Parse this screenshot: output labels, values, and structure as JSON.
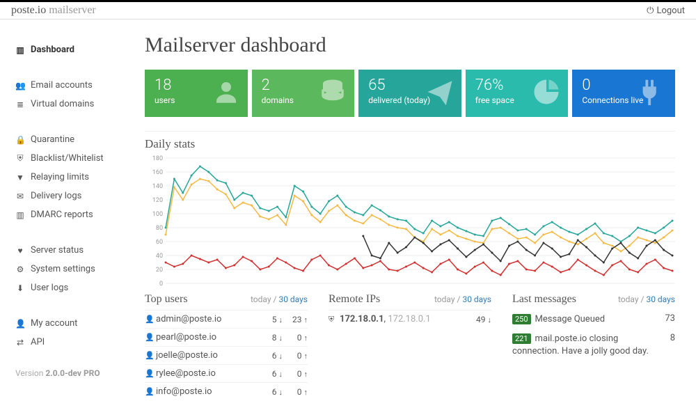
{
  "brand": {
    "main": "poste.io",
    "sub": "mailserver"
  },
  "logout_label": "Logout",
  "sidebar": {
    "groups": [
      [
        {
          "label": "Dashboard",
          "icon": "bars"
        }
      ],
      [
        {
          "label": "Email accounts",
          "icon": "users"
        },
        {
          "label": "Virtual domains",
          "icon": "db"
        }
      ],
      [
        {
          "label": "Quarantine",
          "icon": "lock"
        },
        {
          "label": "Blacklist/Whitelist",
          "icon": "shield"
        },
        {
          "label": "Relaying limits",
          "icon": "filter"
        },
        {
          "label": "Delivery logs",
          "icon": "mail"
        },
        {
          "label": "DMARC reports",
          "icon": "bars"
        }
      ],
      [
        {
          "label": "Server status",
          "icon": "heart"
        },
        {
          "label": "System settings",
          "icon": "gear"
        },
        {
          "label": "User logs",
          "icon": "download"
        }
      ],
      [
        {
          "label": "My account",
          "icon": "user"
        },
        {
          "label": "API",
          "icon": "transfer"
        }
      ]
    ],
    "active": "Dashboard",
    "version_prefix": "Version ",
    "version": "2.0.0-dev PRO"
  },
  "page_title": "Mailserver dashboard",
  "tiles": [
    {
      "value": "18",
      "label": "users",
      "icon": "user",
      "color": "tile-green"
    },
    {
      "value": "2",
      "label": "domains",
      "icon": "db",
      "color": "tile-green2"
    },
    {
      "value": "65",
      "label": "delivered (today)",
      "icon": "send",
      "color": "tile-teal"
    },
    {
      "value": "76%",
      "label": "free space",
      "icon": "pie",
      "color": "tile-teal2"
    },
    {
      "value": "0",
      "label": "Connections live",
      "icon": "plug",
      "color": "tile-blue"
    }
  ],
  "chart_title": "Daily stats",
  "chart_data": {
    "type": "line",
    "xlabel": "",
    "ylabel": "",
    "ylim": [
      0,
      180
    ],
    "yticks": [
      0,
      20,
      40,
      60,
      80,
      100,
      120,
      140,
      160,
      180
    ],
    "x": [
      0,
      1,
      2,
      3,
      4,
      5,
      6,
      7,
      8,
      9,
      10,
      11,
      12,
      13,
      14,
      15,
      16,
      17,
      18,
      19,
      20,
      21,
      22,
      23,
      24,
      25,
      26,
      27,
      28,
      29,
      30,
      31,
      32,
      33,
      34,
      35,
      36,
      37,
      38,
      39,
      40,
      41,
      42,
      43,
      44,
      45,
      46,
      47,
      48,
      49,
      50,
      51,
      52,
      53,
      54,
      55,
      56,
      57,
      58,
      59
    ],
    "series": [
      {
        "name": "teal",
        "color": "#26a69a",
        "values": [
          80,
          150,
          130,
          155,
          168,
          160,
          148,
          144,
          120,
          130,
          126,
          108,
          104,
          110,
          95,
          140,
          132,
          110,
          100,
          118,
          126,
          110,
          102,
          98,
          112,
          105,
          96,
          92,
          90,
          78,
          72,
          90,
          82,
          88,
          80,
          75,
          70,
          68,
          90,
          94,
          85,
          76,
          78,
          70,
          82,
          88,
          80,
          74,
          70,
          78,
          86,
          72,
          68,
          60,
          68,
          80,
          76,
          72,
          80,
          90
        ]
      },
      {
        "name": "orange",
        "color": "#f5b942",
        "values": [
          70,
          138,
          120,
          142,
          150,
          147,
          135,
          128,
          108,
          116,
          112,
          96,
          92,
          98,
          84,
          126,
          118,
          98,
          88,
          104,
          112,
          98,
          90,
          86,
          98,
          92,
          84,
          80,
          78,
          66,
          60,
          78,
          70,
          76,
          68,
          64,
          60,
          58,
          78,
          80,
          72,
          64,
          66,
          58,
          70,
          74,
          66,
          60,
          56,
          64,
          72,
          58,
          54,
          46,
          54,
          66,
          62,
          58,
          66,
          76
        ]
      },
      {
        "name": "red",
        "color": "#d32f2f",
        "values": [
          30,
          24,
          28,
          40,
          35,
          30,
          34,
          22,
          26,
          38,
          32,
          20,
          24,
          36,
          30,
          22,
          18,
          34,
          40,
          26,
          20,
          28,
          36,
          22,
          26,
          32,
          20,
          18,
          24,
          30,
          22,
          16,
          28,
          34,
          20,
          14,
          24,
          30,
          18,
          12,
          28,
          32,
          20,
          18,
          30,
          24,
          16,
          20,
          34,
          26,
          18,
          12,
          26,
          32,
          20,
          16,
          28,
          34,
          22,
          18
        ]
      },
      {
        "name": "black",
        "color": "#333333",
        "values": [
          null,
          null,
          null,
          null,
          null,
          null,
          null,
          null,
          null,
          null,
          null,
          null,
          null,
          null,
          null,
          null,
          null,
          null,
          null,
          null,
          null,
          null,
          null,
          68,
          40,
          36,
          58,
          44,
          52,
          66,
          58,
          46,
          56,
          62,
          50,
          38,
          48,
          56,
          44,
          32,
          54,
          60,
          48,
          40,
          58,
          50,
          38,
          42,
          62,
          52,
          40,
          30,
          50,
          58,
          44,
          36,
          54,
          62,
          48,
          40
        ]
      }
    ]
  },
  "sections": {
    "top_users": {
      "title": "Top users",
      "range": {
        "today": "today",
        "sep": " / ",
        "days": "30 days"
      },
      "rows": [
        {
          "email": "admin@poste.io",
          "v1": "5",
          "v2": "23"
        },
        {
          "email": "pearl@poste.io",
          "v1": "8",
          "v2": "0"
        },
        {
          "email": "joelle@poste.io",
          "v1": "6",
          "v2": "0"
        },
        {
          "email": "rylee@poste.io",
          "v1": "6",
          "v2": "0"
        },
        {
          "email": "info@poste.io",
          "v1": "6",
          "v2": "0"
        }
      ]
    },
    "remote_ips": {
      "title": "Remote IPs",
      "range": {
        "today": "today",
        "sep": " / ",
        "days": "30 days"
      },
      "rows": [
        {
          "ip": "172.18.0.1",
          "rev": "172.18.0.1",
          "v": "49"
        }
      ]
    },
    "last_messages": {
      "title": "Last messages",
      "range": {
        "today": "today",
        "sep": " / ",
        "days": "30 days"
      },
      "rows": [
        {
          "code": "250",
          "text": "Message Queued",
          "count": "73"
        },
        {
          "code": "221",
          "text": "mail.poste.io closing connection. Have a jolly good day.",
          "count": "8"
        }
      ]
    }
  }
}
